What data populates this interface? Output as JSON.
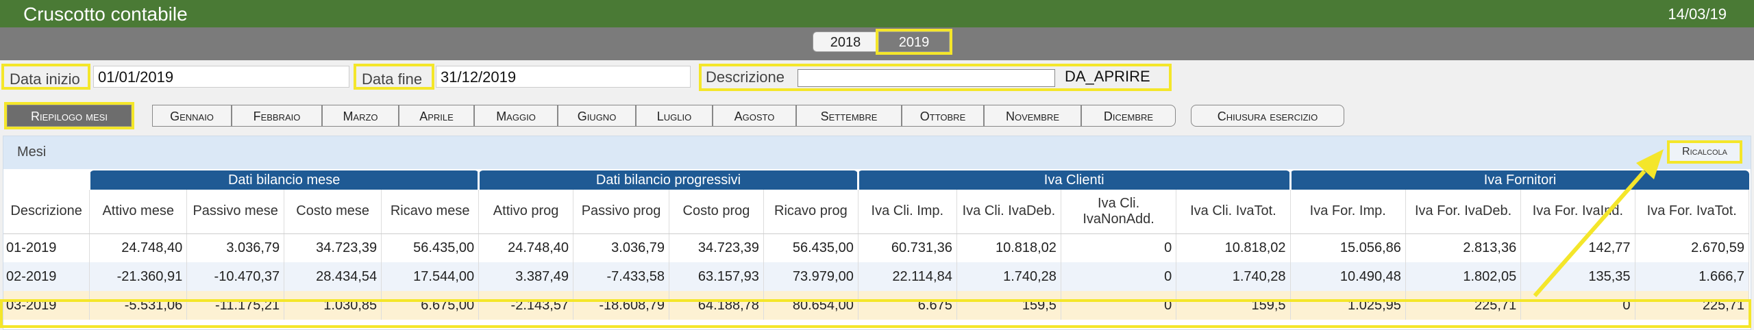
{
  "app": {
    "title": "Cruscotto contabile",
    "date": "14/03/19"
  },
  "years": [
    "2018",
    "2019"
  ],
  "filters": {
    "start_label": "Data inizio",
    "start_value": "01/01/2019",
    "end_label": "Data fine",
    "end_value": "31/12/2019",
    "desc_label": "Descrizione",
    "desc_value": "",
    "desc_extra": "DA_APRIRE"
  },
  "tabs": [
    "Riepilogo mesi",
    "Gennaio",
    "Febbraio",
    "Marzo",
    "Aprile",
    "Maggio",
    "Giugno",
    "Luglio",
    "Agosto",
    "Settembre",
    "Ottobre",
    "Novembre",
    "Dicembre",
    "Chiusura esercizio"
  ],
  "panel": {
    "title": "Mesi",
    "recalc_label": "Ricalcola"
  },
  "groups": [
    "Dati bilancio mese",
    "Dati bilancio progressivi",
    "Iva Clienti",
    "Iva Fornitori"
  ],
  "columns": [
    "Descrizione",
    "Attivo mese",
    "Passivo mese",
    "Costo mese",
    "Ricavo mese",
    "Attivo prog",
    "Passivo prog",
    "Costo prog",
    "Ricavo prog",
    "Iva Cli. Imp.",
    "Iva Cli. IvaDeb.",
    "Iva Cli. IvaNonAdd.",
    "Iva Cli. IvaTot.",
    "Iva For. Imp.",
    "Iva For. IvaDeb.",
    "Iva For. IvaInd.",
    "Iva For. IvaTot."
  ],
  "rows": [
    [
      "01-2019",
      "24.748,40",
      "3.036,79",
      "34.723,39",
      "56.435,00",
      "24.748,40",
      "3.036,79",
      "34.723,39",
      "56.435,00",
      "60.731,36",
      "10.818,02",
      "0",
      "10.818,02",
      "15.056,86",
      "2.813,36",
      "142,77",
      "2.670,59"
    ],
    [
      "02-2019",
      "-21.360,91",
      "-10.470,37",
      "28.434,54",
      "17.544,00",
      "3.387,49",
      "-7.433,58",
      "63.157,93",
      "73.979,00",
      "22.114,84",
      "1.740,28",
      "0",
      "1.740,28",
      "10.490,48",
      "1.802,05",
      "135,35",
      "1.666,7"
    ],
    [
      "03-2019",
      "-5.531,06",
      "-11.175,21",
      "1.030,85",
      "6.675,00",
      "-2.143,57",
      "-18.608,79",
      "64.188,78",
      "80.654,00",
      "6.675",
      "159,5",
      "0",
      "159,5",
      "1.025,95",
      "225,71",
      "0",
      "225,71"
    ]
  ],
  "colors": {
    "topbar": "#4a7a35",
    "header_blue": "#1f5a94",
    "highlight": "#f4e62a"
  }
}
